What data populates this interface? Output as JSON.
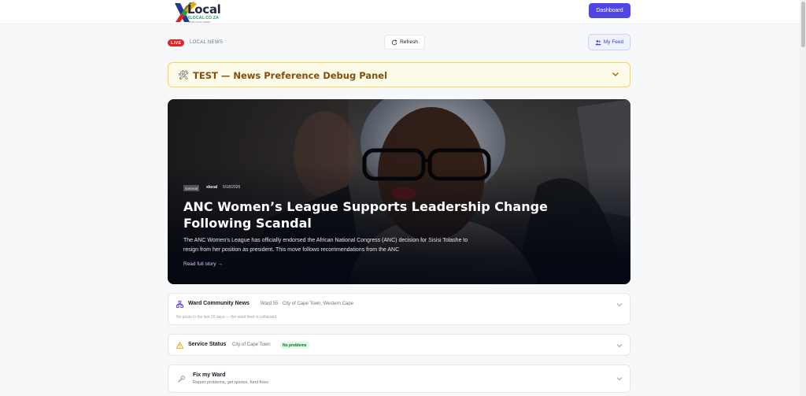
{
  "header": {
    "logo_word": "Local",
    "logo_domain": "XLOCAL.CO.ZA",
    "logo_tagline": "YOUR LOCAL NEWS",
    "dashboard_label": "Dashboard"
  },
  "toolbar": {
    "live_label": "LIVE",
    "section_label": "LOCAL NEWS",
    "refresh_label": "Refresh",
    "feed_label": "My Feed"
  },
  "debug_panel": {
    "icon": "tools-icon",
    "title": "TEST — News Preference Debug Panel"
  },
  "hero": {
    "category": "General",
    "source": "xlocal",
    "date": "5/18/2026",
    "title": "ANC Women’s League Supports Leadership Change Following Scandal",
    "excerpt": "The ANC Women's League has officially endorsed the African National Congress (ANC) decision for Sisisi Tolashe to resign from her position as president. This move follows recommendations from the ANC",
    "link": "Read full story →"
  },
  "ward_news": {
    "title": "Ward Community News",
    "meta": "Ward 55 · City of Cape Town, Western Cape",
    "note": "No posts in the last 30 days — the ward feed is collapsed."
  },
  "service_status": {
    "title": "Service Status",
    "meta": "City of Cape Town",
    "badge": "No problems"
  },
  "fix_ward": {
    "title": "Fix my Ward",
    "subtitle": "Report problems, get quotes, fund fixes"
  },
  "colors": {
    "accent": "#4f46e5",
    "live": "#dc2626",
    "debug_bg": "#fefce8",
    "debug_border": "#fcd34d",
    "ok_bg": "#dcfce7",
    "warning": "#f59e0b"
  }
}
